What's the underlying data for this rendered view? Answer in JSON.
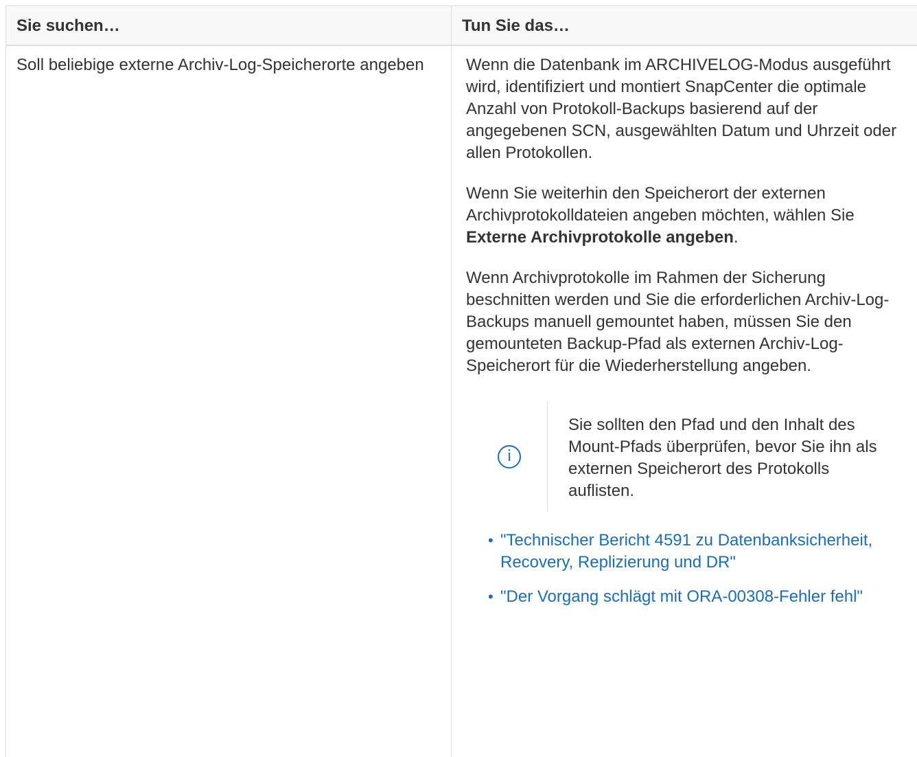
{
  "table": {
    "headers": [
      "Sie suchen…",
      "Tun Sie das…"
    ],
    "row": {
      "left": "Soll beliebige externe Archiv-Log-Speicherorte angeben",
      "right": {
        "para1": "Wenn die Datenbank im ARCHIVELOG-Modus ausgeführt wird, identifiziert und montiert SnapCenter die optimale Anzahl von Protokoll-Backups basierend auf der angegebenen SCN, ausgewählten Datum und Uhrzeit oder allen Protokollen.",
        "para2_before": "Wenn Sie weiterhin den Speicherort der externen Archivprotokolldateien angeben möchten, wählen Sie ",
        "para2_bold": "Externe Archivprotokolle angeben",
        "para2_after": ".",
        "para3": "Wenn Archivprotokolle im Rahmen der Sicherung beschnitten werden und Sie die erforderlichen Archiv-Log-Backups manuell gemountet haben, müssen Sie den gemounteten Backup-Pfad als externen Archiv-Log-Speicherort für die Wiederherstellung angeben.",
        "note": {
          "icon": "info-icon",
          "text": "Sie sollten den Pfad und den Inhalt des Mount-Pfads überprüfen, bevor Sie ihn als externen Speicherort des Protokolls auflisten."
        },
        "links": [
          "\"Technischer Bericht 4591 zu Datenbanksicherheit, Recovery, Replizierung und DR\"",
          "\"Der Vorgang schlägt mit ORA-00308-Fehler fehl\""
        ]
      }
    }
  },
  "colors": {
    "text": "#333333",
    "link": "#1a6eb8",
    "border": "#dddddd",
    "header_bg": "#f8f8f8"
  }
}
